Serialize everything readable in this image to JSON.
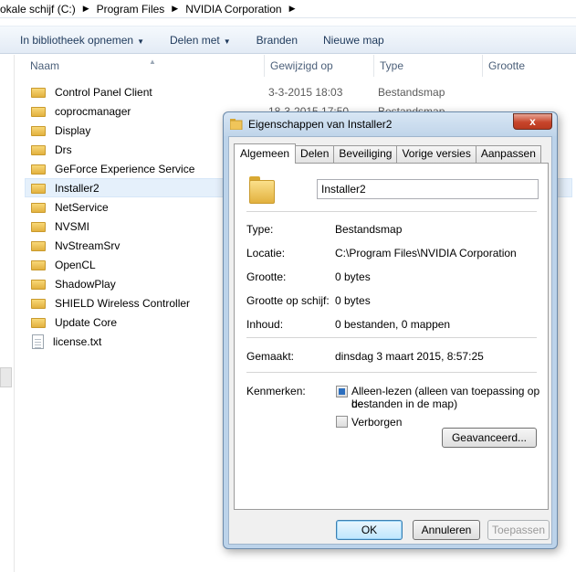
{
  "explorer": {
    "breadcrumb": [
      "okale schijf (C:)",
      "Program Files",
      "NVIDIA Corporation"
    ],
    "toolbar": {
      "include_library": "In bibliotheek opnemen",
      "share_with": "Delen met",
      "burn": "Branden",
      "new_folder": "Nieuwe map"
    },
    "columns": {
      "name": "Naam",
      "modified": "Gewijzigd op",
      "type": "Type",
      "size": "Grootte"
    },
    "files": [
      {
        "name": "Control Panel Client",
        "kind": "folder",
        "date": "3-3-2015 18:03",
        "type": "Bestandsmap"
      },
      {
        "name": "coprocmanager",
        "kind": "folder",
        "date": "18-3-2015 17:50",
        "type": "Bestandsmap"
      },
      {
        "name": "Display",
        "kind": "folder",
        "date": "",
        "type": ""
      },
      {
        "name": "Drs",
        "kind": "folder",
        "date": "",
        "type": ""
      },
      {
        "name": "GeForce Experience Service",
        "kind": "folder",
        "date": "",
        "type": ""
      },
      {
        "name": "Installer2",
        "kind": "folder",
        "date": "",
        "type": "",
        "selected": true
      },
      {
        "name": "NetService",
        "kind": "folder",
        "date": "",
        "type": ""
      },
      {
        "name": "NVSMI",
        "kind": "folder",
        "date": "",
        "type": ""
      },
      {
        "name": "NvStreamSrv",
        "kind": "folder",
        "date": "",
        "type": ""
      },
      {
        "name": "OpenCL",
        "kind": "folder",
        "date": "",
        "type": ""
      },
      {
        "name": "ShadowPlay",
        "kind": "folder",
        "date": "",
        "type": ""
      },
      {
        "name": "SHIELD Wireless Controller",
        "kind": "folder",
        "date": "",
        "type": ""
      },
      {
        "name": "Update Core",
        "kind": "folder",
        "date": "",
        "type": ""
      },
      {
        "name": "license.txt",
        "kind": "file",
        "date": "",
        "type": ""
      }
    ]
  },
  "dialog": {
    "title": "Eigenschappen van Installer2",
    "close_glyph": "x",
    "tabs": [
      "Algemeen",
      "Delen",
      "Beveiliging",
      "Vorige versies",
      "Aanpassen"
    ],
    "active_tab": "Algemeen",
    "folder_name": "Installer2",
    "props": {
      "type_label": "Type:",
      "type_value": "Bestandsmap",
      "location_label": "Locatie:",
      "location_value": "C:\\Program Files\\NVIDIA Corporation",
      "size_label": "Grootte:",
      "size_value": "0 bytes",
      "disk_size_label": "Grootte op schijf:",
      "disk_size_value": "0 bytes",
      "contents_label": "Inhoud:",
      "contents_value": "0 bestanden, 0 mappen",
      "created_label": "Gemaakt:",
      "created_value": "dinsdag 3 maart 2015, 8:57:25",
      "attributes_label": "Kenmerken:",
      "readonly_label": "Alleen-lezen (alleen van toepassing op de",
      "readonly_label_2": "bestanden in de map)",
      "hidden_label": "Verborgen",
      "advanced_button": "Geavanceerd..."
    },
    "buttons": {
      "ok": "OK",
      "cancel": "Annuleren",
      "apply": "Toepassen"
    }
  }
}
